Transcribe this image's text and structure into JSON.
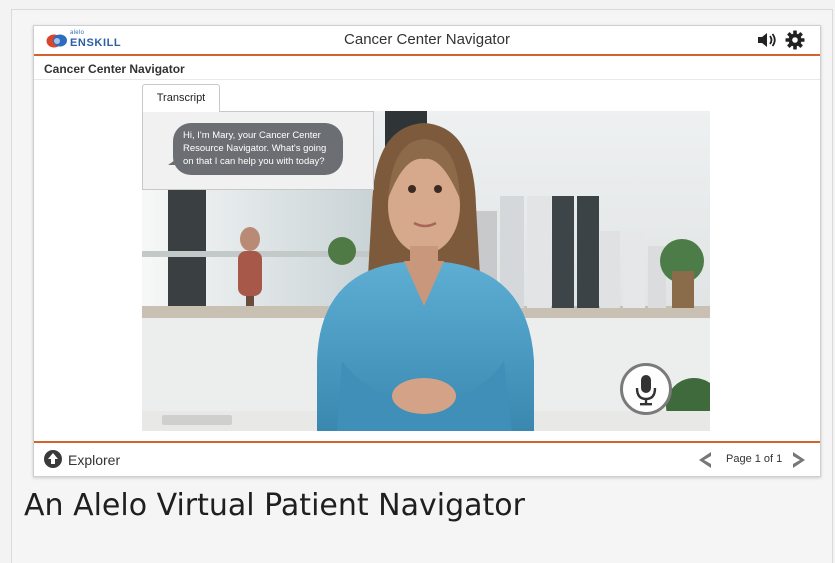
{
  "logo": {
    "small": "alelo",
    "big": "ENSKILL"
  },
  "window": {
    "title": "Cancer Center Navigator"
  },
  "icons": {
    "sound": "speaker-icon",
    "settings": "gear-icon",
    "mic": "microphone-icon",
    "explorer": "arrow-up-circle-icon",
    "prev": "chevron-left-icon",
    "next": "chevron-right-icon"
  },
  "header": {
    "section_title": "Cancer Center Navigator"
  },
  "transcript": {
    "tab_label": "Transcript",
    "message": "Hi, I'm Mary, your Cancer Center Resource Navigator. What's going on that I can help you with today?"
  },
  "footer": {
    "explorer_label": "Explorer",
    "page_label": "Page 1 of 1"
  },
  "caption": "An Alelo Virtual Patient Navigator",
  "colors": {
    "accent": "#d4622b",
    "bubble": "#6b6e73",
    "scrub": "#4a9cc4"
  }
}
